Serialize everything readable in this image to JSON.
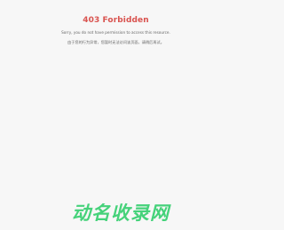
{
  "error": {
    "title": "403 Forbidden",
    "message": "Sorry, you do not have permission to access this resource.",
    "hint": "由于您的行为异常，您暂时无法访问该页面，请稍后再试。"
  },
  "brand": {
    "logo_text": "动名收录网",
    "logo_color": "#45d27a"
  },
  "colors": {
    "background": "#f7f7f7",
    "title": "#d9534f",
    "text": "#666666"
  }
}
